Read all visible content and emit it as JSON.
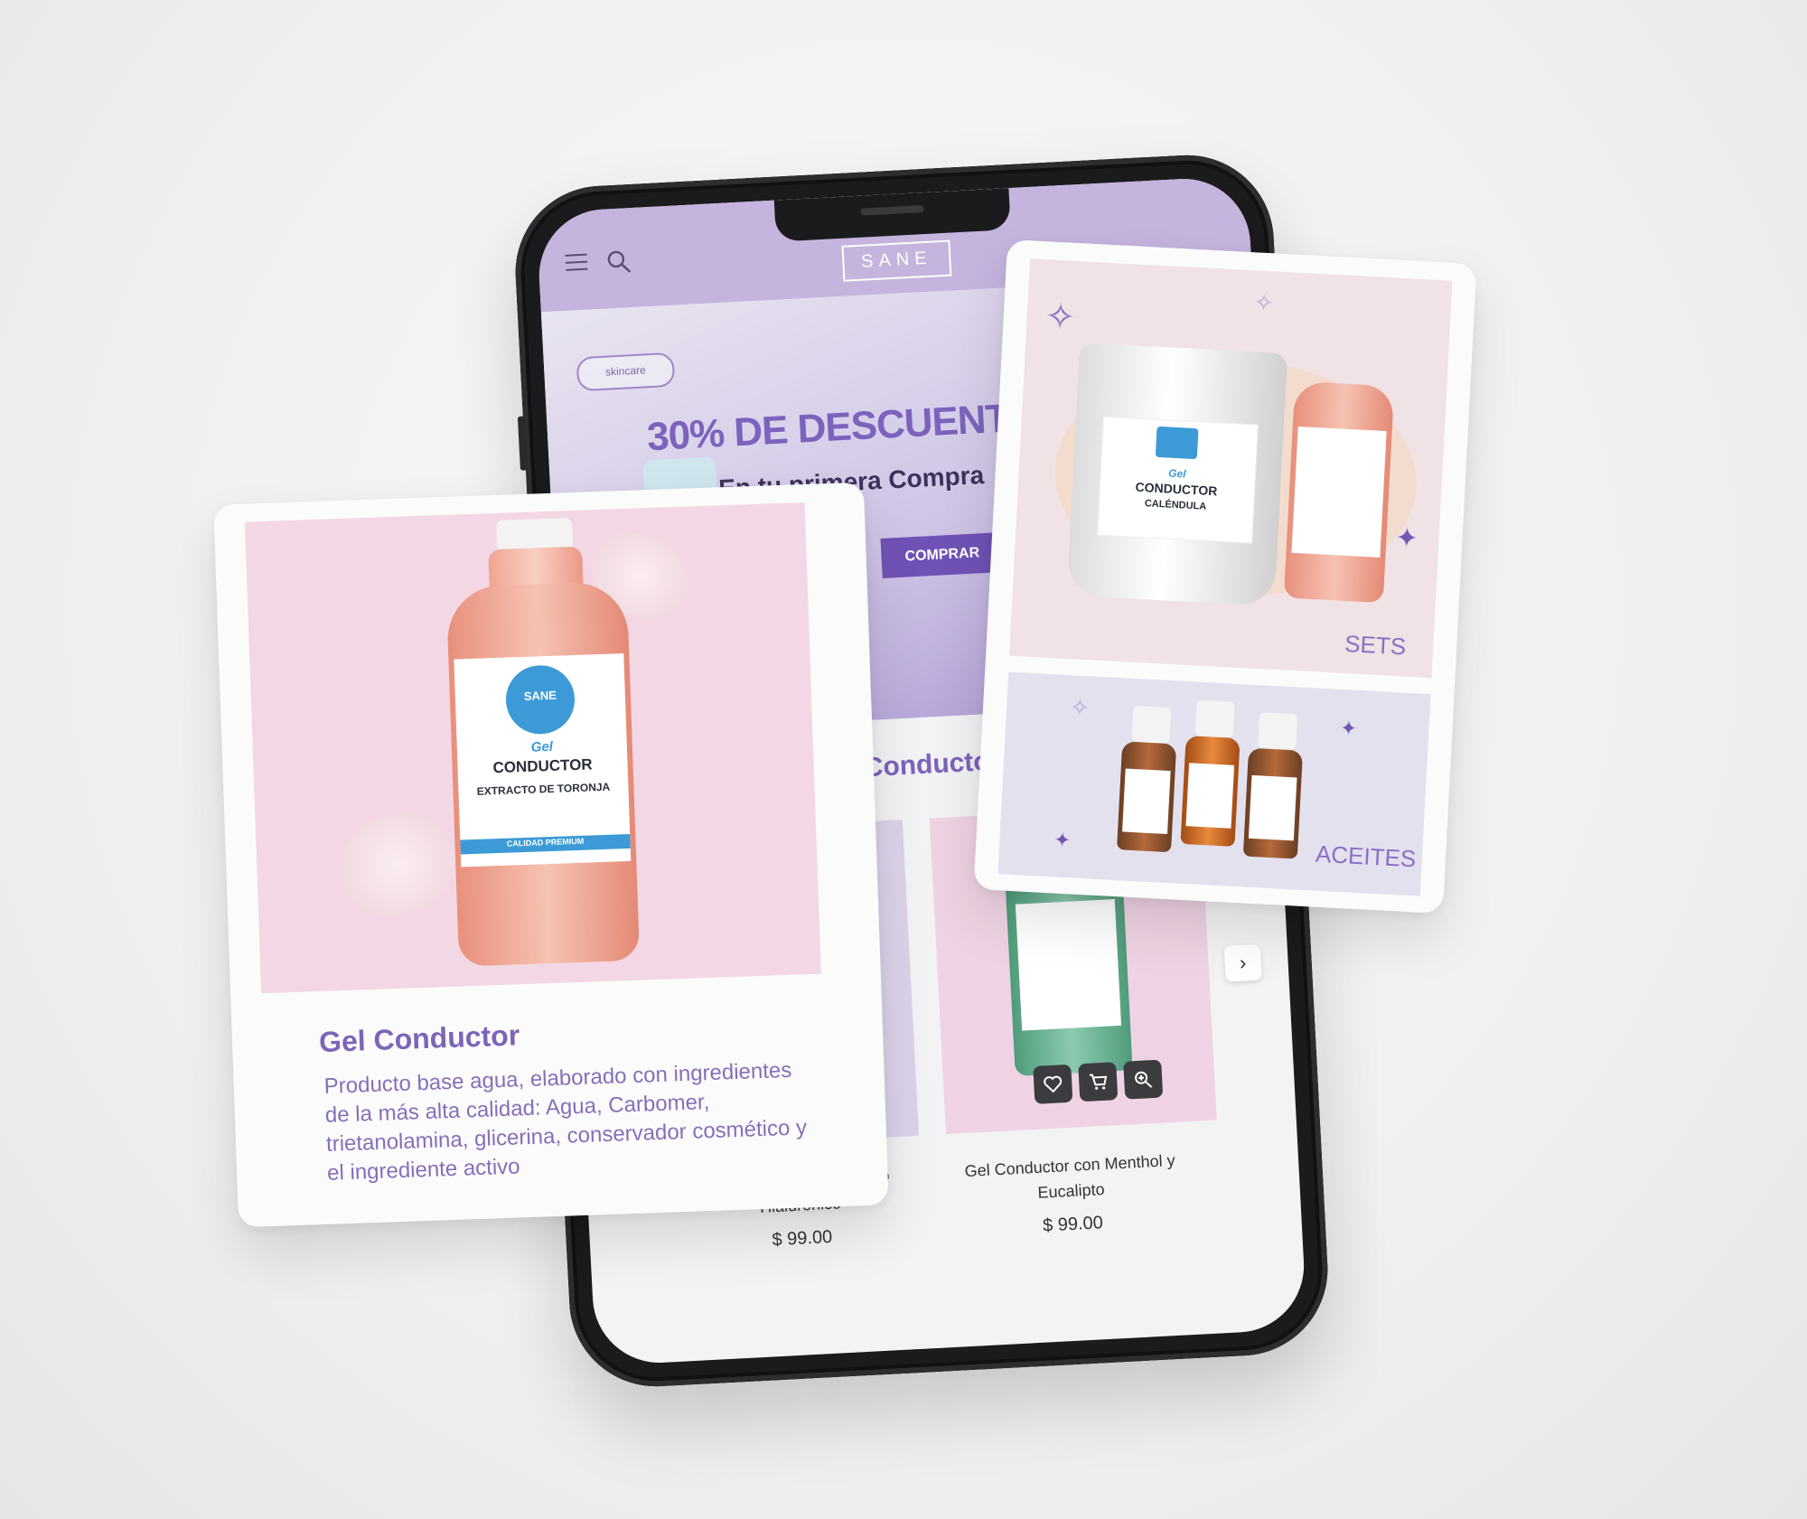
{
  "header": {
    "logo": "SANE"
  },
  "hero": {
    "pill": "skincare",
    "title": "30% DE DESCUENTO",
    "subtitle": "En tu primera Compra",
    "button": "COMPRAR"
  },
  "section": {
    "title": "Geles Conductores"
  },
  "products": [
    {
      "name": "Gel Conductor con Ácido Hialurónico",
      "price": "$ 99.00"
    },
    {
      "name": "Gel Conductor con Menthol y Eucalipto",
      "price": "$ 99.00"
    }
  ],
  "feature_card": {
    "title": "Gel Conductor",
    "description": "Producto base agua, elaborado con ingredientes de la más alta calidad: Agua, Carbomer, trietanolamina, glicerina, conservador cosmético y el ingrediente activo",
    "label_brand": "SANE",
    "label_gel": "Gel",
    "label_conductor": "CONDUCTOR",
    "label_extract": "EXTRACTO DE TORONJA",
    "label_quality": "CALIDAD PREMIUM"
  },
  "categories": {
    "sets": "SETS",
    "oils": "ACEITES"
  },
  "bucket_label": {
    "gel": "Gel",
    "conductor": "CONDUCTOR",
    "variant": "CALÉNDULA"
  },
  "colors": {
    "accent": "#7b63bd",
    "header": "#c4b4de",
    "button": "#7052b6"
  },
  "icons": {
    "menu": "hamburger-icon",
    "search": "search-icon",
    "wishlist": "heart-icon",
    "cart": "cart-icon",
    "zoom": "zoom-in-icon",
    "next": "chevron-right-icon"
  }
}
